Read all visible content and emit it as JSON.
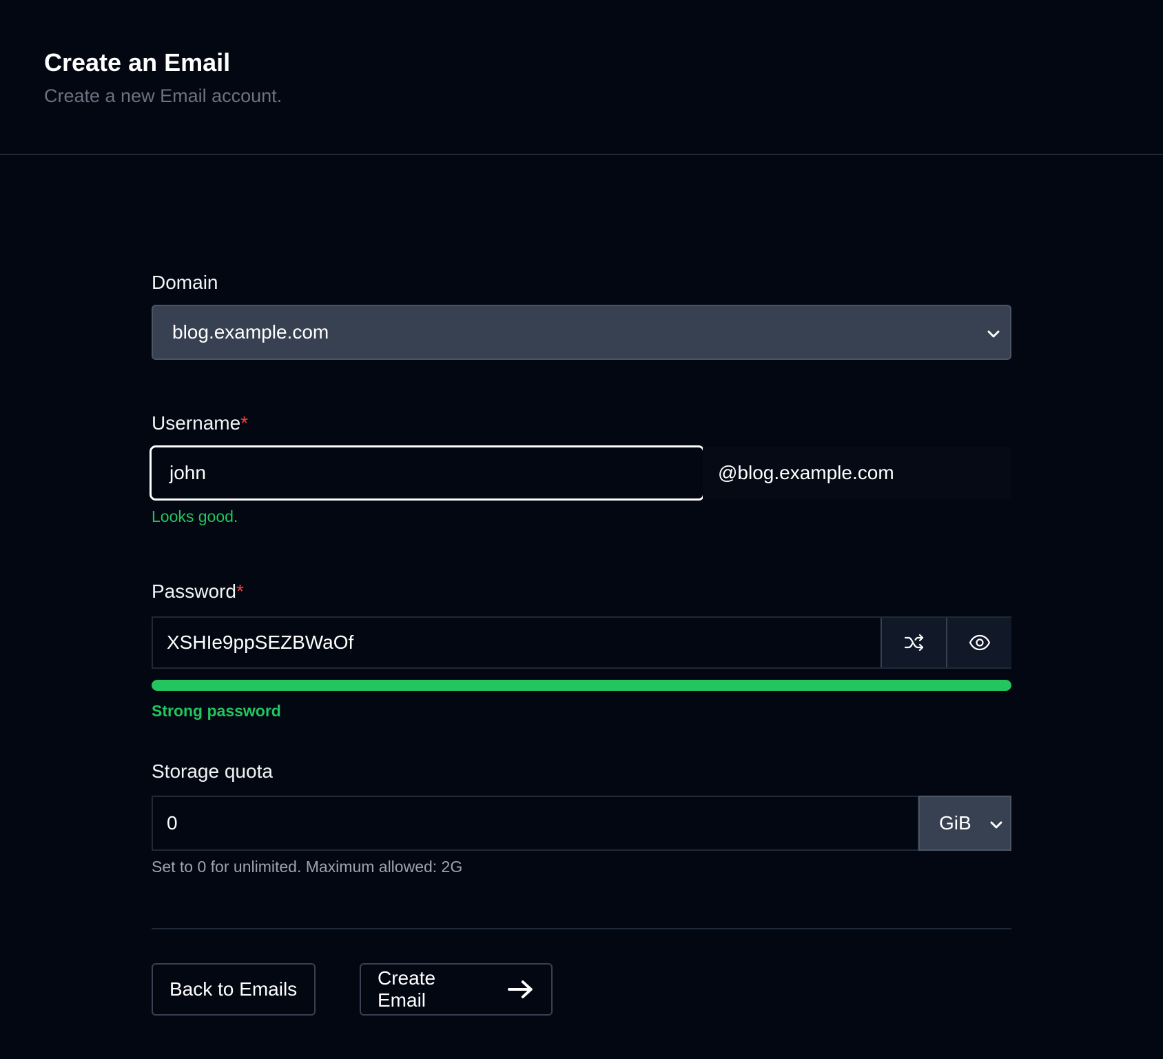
{
  "header": {
    "title": "Create an Email",
    "subtitle": "Create a new Email account."
  },
  "domain": {
    "label": "Domain",
    "selected": "blog.example.com"
  },
  "username": {
    "label": "Username",
    "required_mark": "*",
    "value": "john",
    "suffix": "@blog.example.com",
    "feedback": "Looks good."
  },
  "password": {
    "label": "Password",
    "required_mark": "*",
    "value": "XSHIe9ppSEZBWaOf",
    "strength_percent": 100,
    "strength_text": "Strong password",
    "generate_icon": "shuffle-icon",
    "toggle_icon": "eye-icon"
  },
  "storage": {
    "label": "Storage quota",
    "value": "0",
    "unit": "GiB",
    "help": "Set to 0 for unlimited. Maximum allowed: 2G"
  },
  "actions": {
    "back_label": "Back to Emails",
    "create_label": "Create Email"
  },
  "colors": {
    "background": "#030712",
    "success": "#22c55e",
    "required": "#ef4444",
    "select_bg": "#374151"
  }
}
